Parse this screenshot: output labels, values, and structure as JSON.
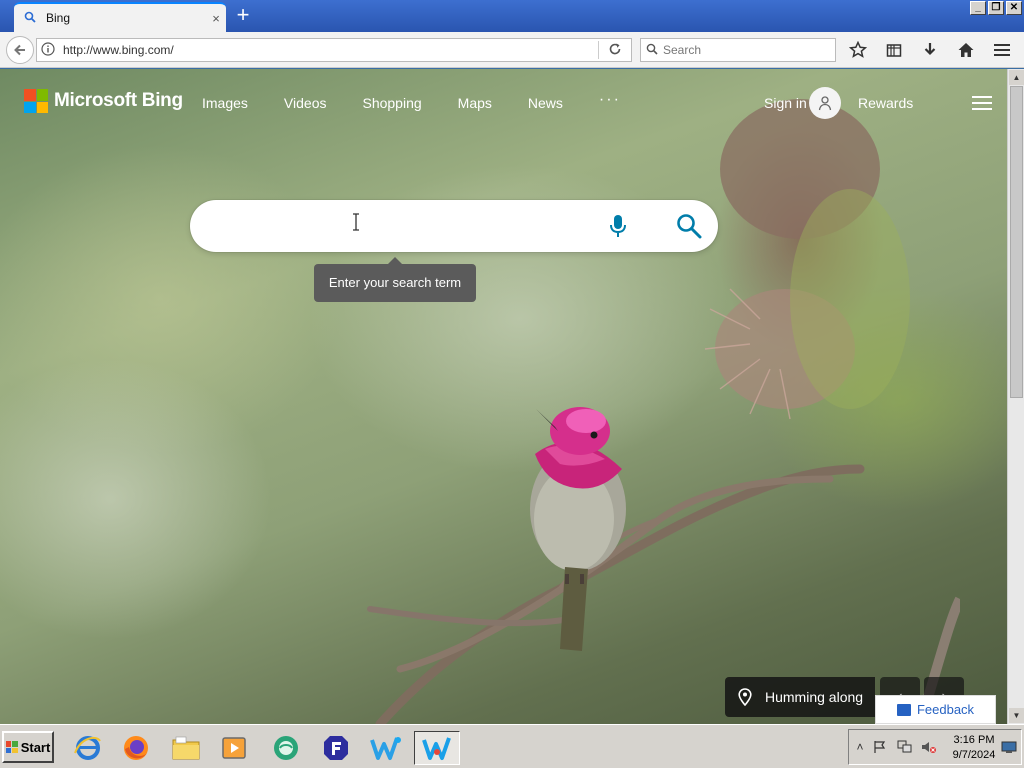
{
  "browser": {
    "tab_title": "Bing",
    "tab_close": "×",
    "new_tab": "+",
    "url": "http://www.bing.com/",
    "search_placeholder": "Search",
    "window_buttons": [
      "_",
      "❐",
      "✕"
    ]
  },
  "bing": {
    "logo_text": "Microsoft Bing",
    "logo_colors": [
      "#f25022",
      "#7fba00",
      "#00a4ef",
      "#ffb900"
    ],
    "scopes": [
      {
        "label": "Images"
      },
      {
        "label": "Videos"
      },
      {
        "label": "Shopping"
      },
      {
        "label": "Maps"
      },
      {
        "label": "News"
      },
      {
        "label": "···"
      }
    ],
    "sign_in": "Sign in",
    "rewards": "Rewards",
    "search": {
      "value": "",
      "tooltip": "Enter your search term",
      "accent_color": "#007daa"
    },
    "image_caption": "Humming along",
    "feedback": "Feedback"
  },
  "taskbar": {
    "start_label": "Start",
    "clock_time": "3:16 PM",
    "clock_date": "9/7/2024"
  }
}
